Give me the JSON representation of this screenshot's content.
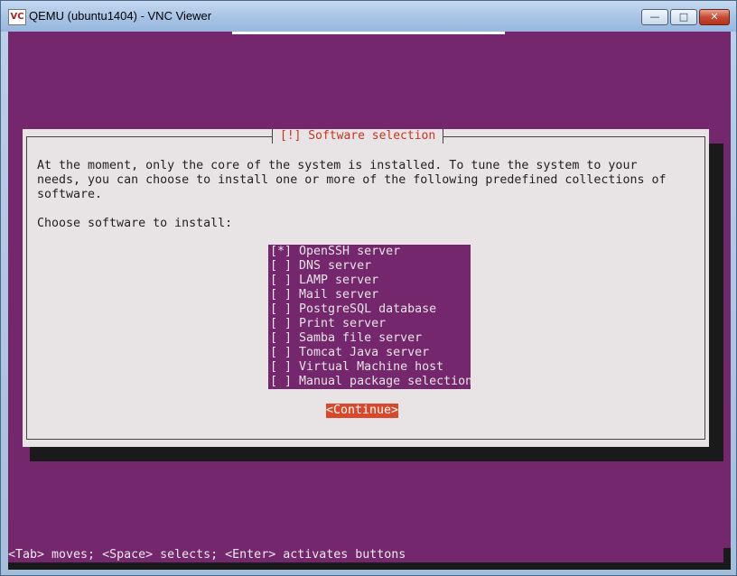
{
  "window": {
    "app_icon_text": "VC",
    "title": "QEMU (ubuntu1404) - VNC Viewer",
    "min_glyph": "—",
    "max_glyph": "□",
    "close_glyph": "✕"
  },
  "dialog": {
    "title": "[!] Software selection",
    "description": "At the moment, only the core of the system is installed. To tune the system to your\nneeds, you can choose to install one or more of the following predefined collections of\nsoftware.",
    "prompt": "Choose software to install:",
    "options": [
      {
        "label": "[*] OpenSSH server",
        "checked": true
      },
      {
        "label": "[ ] DNS server",
        "checked": false
      },
      {
        "label": "[ ] LAMP server",
        "checked": false
      },
      {
        "label": "[ ] Mail server",
        "checked": false
      },
      {
        "label": "[ ] PostgreSQL database",
        "checked": false
      },
      {
        "label": "[ ] Print server",
        "checked": false
      },
      {
        "label": "[ ] Samba file server",
        "checked": false
      },
      {
        "label": "[ ] Tomcat Java server",
        "checked": false
      },
      {
        "label": "[ ] Virtual Machine host",
        "checked": false
      },
      {
        "label": "[ ] Manual package selection",
        "checked": false
      }
    ],
    "continue_label": "<Continue>"
  },
  "status_bar": {
    "text": "<Tab> moves; <Space> selects; <Enter> activates buttons"
  },
  "colors": {
    "terminal_bg": "#75276e",
    "dialog_bg": "#e8e4e6",
    "accent": "#d9482b",
    "title_text": "#c4361f"
  }
}
